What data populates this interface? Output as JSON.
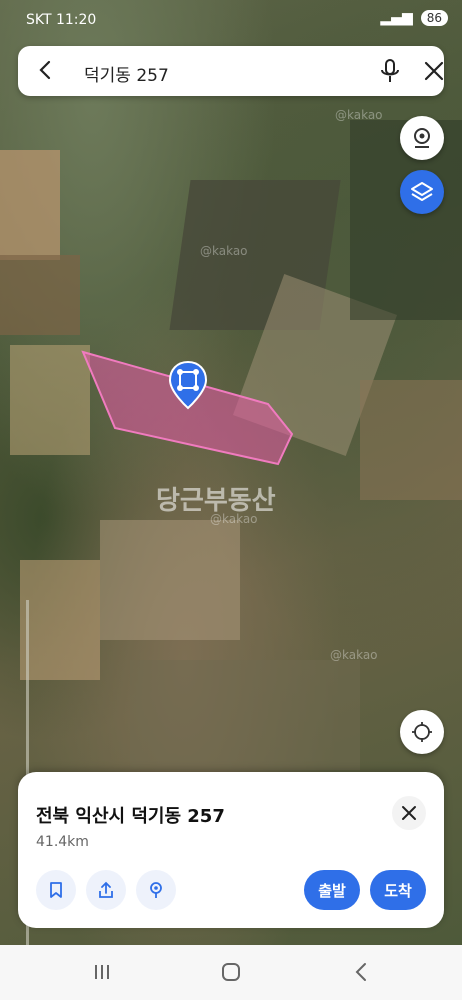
{
  "status_bar": {
    "carrier_time": "SKT 11:20",
    "battery": "86"
  },
  "search": {
    "query": "덕기동 257"
  },
  "map": {
    "watermark": "당근부동산",
    "kakao_marks": [
      "@kakao",
      "@kakao",
      "@kakao",
      "@kakao"
    ]
  },
  "sheet": {
    "title": "전북 익산시 덕기동 257",
    "distance": "41.4km",
    "depart_label": "출발",
    "arrive_label": "도착"
  },
  "colors": {
    "accent": "#2f6fe8",
    "parcel": "#e45aa6"
  }
}
